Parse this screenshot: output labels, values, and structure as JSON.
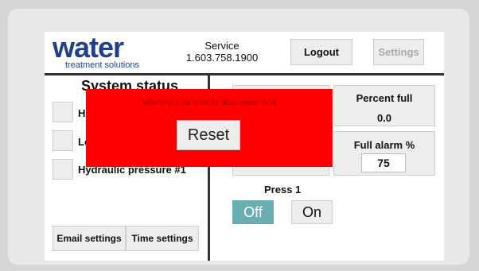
{
  "header": {
    "logo_main": "water",
    "logo_sub": "treatment solutions",
    "service_label": "Service",
    "service_phone": "1.603.758.1900",
    "logout_label": "Logout",
    "settings_label": "Settings"
  },
  "left_panel": {
    "title": "System status",
    "items": [
      {
        "label": "H"
      },
      {
        "label": "Lo"
      },
      {
        "label": "Hydraulic pressure #1"
      }
    ],
    "email_button": "Email settings",
    "time_button": "Time settings"
  },
  "right_panel": {
    "percent_full_label": "Percent full",
    "percent_full_value": "0.0",
    "full_alarm_label": "Full alarm %",
    "full_alarm_value": "75",
    "press_label": "Press 1",
    "off_label": "Off",
    "on_label": "On"
  },
  "warning": {
    "message": "Warning: Low level in clear water tank",
    "reset_label": "Reset"
  },
  "colors": {
    "brand": "#1f3f8f",
    "warning_bg": "#ff0000",
    "off_active": "#6aaeb2"
  }
}
